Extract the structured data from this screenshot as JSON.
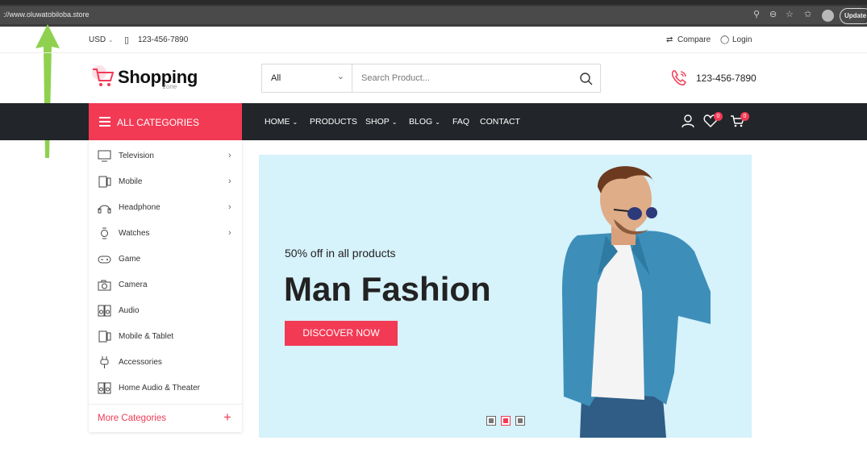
{
  "browser": {
    "url": "://www.oluwatobiloba.store",
    "update_label": "Update"
  },
  "top_bar": {
    "currency": "USD",
    "phone": "123-456-7890",
    "compare": "Compare",
    "login": "Login"
  },
  "header": {
    "logo_main": "Shopping",
    "logo_sub": "zone",
    "category_select": "All",
    "search_placeholder": "Search Product...",
    "phone": "123-456-7890"
  },
  "nav": {
    "all_categories": "ALL CATEGORIES",
    "items": [
      {
        "label": "HOME",
        "dropdown": true
      },
      {
        "label": "PRODUCTS",
        "dropdown": false
      },
      {
        "label": "SHOP",
        "dropdown": true
      },
      {
        "label": "BLOG",
        "dropdown": true
      },
      {
        "label": "FAQ",
        "dropdown": false
      },
      {
        "label": "CONTACT",
        "dropdown": false
      }
    ],
    "wishlist_count": "0",
    "cart_count": "0"
  },
  "sidebar": {
    "items": [
      {
        "label": "Television",
        "icon": "tv-icon",
        "submenu": true
      },
      {
        "label": "Mobile",
        "icon": "mobile-icon",
        "submenu": true
      },
      {
        "label": "Headphone",
        "icon": "headphone-icon",
        "submenu": true
      },
      {
        "label": "Watches",
        "icon": "watch-icon",
        "submenu": true
      },
      {
        "label": "Game",
        "icon": "gamepad-icon",
        "submenu": false
      },
      {
        "label": "Camera",
        "icon": "camera-icon",
        "submenu": false
      },
      {
        "label": "Audio",
        "icon": "speaker-icon",
        "submenu": false
      },
      {
        "label": "Mobile & Tablet",
        "icon": "tablet-icon",
        "submenu": false
      },
      {
        "label": "Accessories",
        "icon": "plug-icon",
        "submenu": false
      },
      {
        "label": "Home Audio & Theater",
        "icon": "speaker-icon",
        "submenu": false
      }
    ],
    "more_label": "More Categories"
  },
  "hero": {
    "subtitle": "50% off in all products",
    "title": "Man Fashion",
    "button": "DISCOVER NOW",
    "slides": 3,
    "active_slide": 2
  },
  "colors": {
    "accent": "#f23a55",
    "nav_bg": "#222529",
    "hero_bg": "#d6f2fb",
    "annotation_arrow": "#8fd14f"
  }
}
